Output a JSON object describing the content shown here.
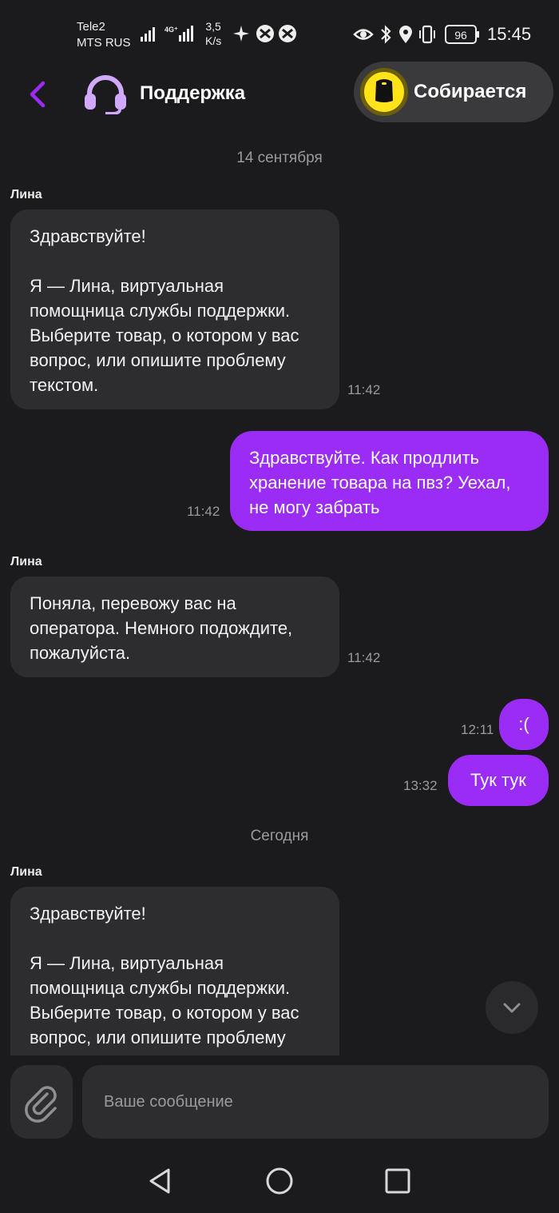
{
  "status_bar": {
    "carrier1": "Tele2",
    "carrier2": "MTS RUS",
    "speed_value": "3,5",
    "speed_unit": "K/s",
    "battery": "96",
    "time": "15:45"
  },
  "header": {
    "title": "Поддержка",
    "order_status": "Собирается"
  },
  "colors": {
    "accent": "#9b2cf5",
    "background": "#1b1b1d",
    "incoming_bubble": "#2d2d30",
    "order_yellow": "#ffe41a"
  },
  "chat": {
    "date1": "14 сентября",
    "date2": "Сегодня",
    "messages": [
      {
        "sender": "Лина",
        "text": "Здравствуйте!\n\nЯ — Лина, виртуальная помощница службы поддержки. Выберите товар, о котором у вас вопрос, или опишите проблему текстом.",
        "time": "11:42"
      },
      {
        "text": "Здравствуйте. Как продлить хранение товара на пвз? Уехал, не могу забрать",
        "time": "11:42"
      },
      {
        "sender": "Лина",
        "text": "Поняла, перевожу вас на оператора. Немного подождите, пожалуйста.",
        "time": "11:42"
      },
      {
        "text": ":(",
        "time": "12:11"
      },
      {
        "text": "Тук тук",
        "time": "13:32"
      },
      {
        "sender": "Лина",
        "text": "Здравствуйте!\n\nЯ — Лина, виртуальная помощница службы поддержки. Выберите товар, о котором у вас вопрос, или опишите проблему"
      }
    ]
  },
  "composer": {
    "placeholder": "Ваше сообщение"
  }
}
